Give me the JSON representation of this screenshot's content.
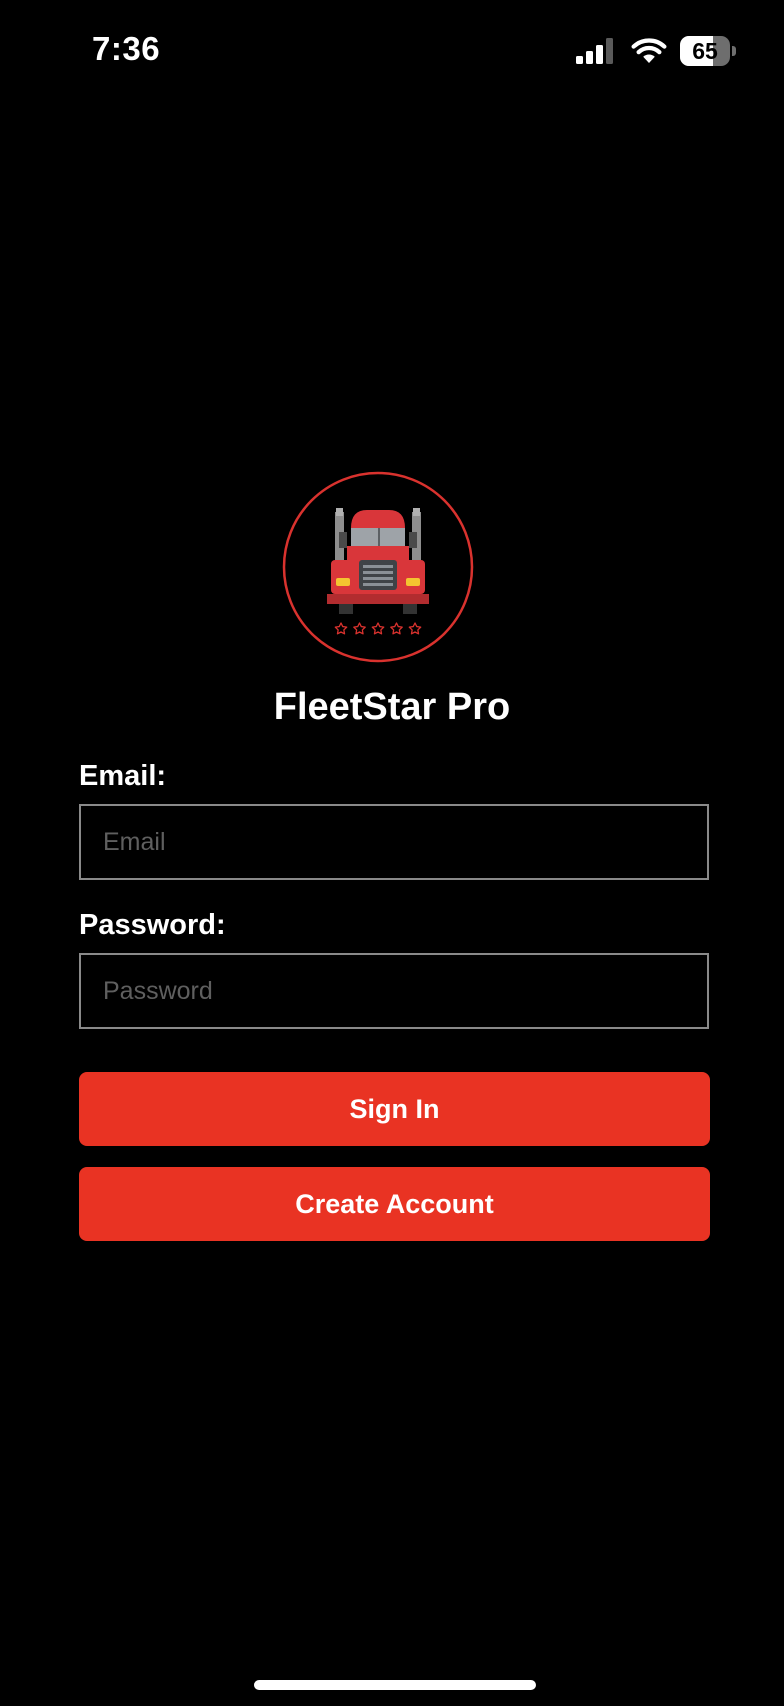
{
  "status_bar": {
    "time": "7:36",
    "battery_level": "65",
    "battery_fraction": 0.65,
    "signal_bars_active": 3,
    "signal_bars_total": 4,
    "signal_icon": "cellular-signal-icon",
    "wifi_icon": "wifi-icon"
  },
  "logo": {
    "icon": "semi-truck-icon",
    "stars_count": 5,
    "accent_color": "#e03a36"
  },
  "app": {
    "title": "FleetStar Pro"
  },
  "form": {
    "email_label": "Email:",
    "email_placeholder": "Email",
    "email_value": "",
    "password_label": "Password:",
    "password_placeholder": "Password",
    "password_value": ""
  },
  "actions": {
    "sign_in_label": "Sign In",
    "create_account_label": "Create Account",
    "button_color": "#e93323"
  }
}
